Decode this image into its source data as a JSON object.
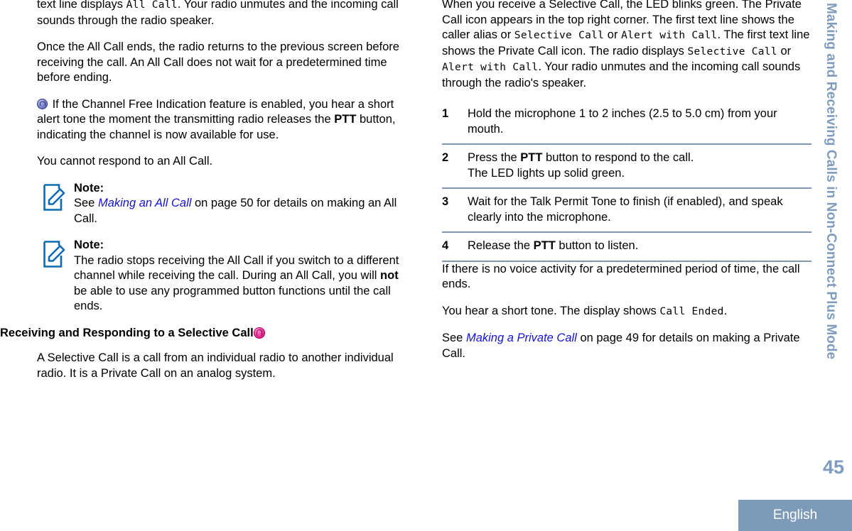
{
  "document": {
    "rail_title": "Making and Receiving Calls in Non-Connect Plus Mode",
    "page_number": "45",
    "language_badge": "English"
  },
  "left_column": {
    "paragraphs": [
      {
        "id": "p1",
        "segments": [
          {
            "type": "text",
            "text": "text line displays "
          },
          {
            "type": "mono",
            "text": "All Call"
          },
          {
            "type": "text",
            "text": ". Your radio unmutes and the incoming call sounds through the radio speaker."
          }
        ]
      },
      {
        "id": "p2",
        "segments": [
          {
            "type": "text",
            "text": "Once the All Call ends, the radio returns to the previous screen before receiving the call. An All Call does not wait for a predetermined time before ending."
          }
        ]
      },
      {
        "id": "p3",
        "icon": "channel-free-indication-icon",
        "segments": [
          {
            "type": "text",
            "text": " If the Channel Free Indication feature is enabled, you hear a short alert tone the moment the transmitting radio releases the "
          },
          {
            "type": "bold",
            "text": "PTT"
          },
          {
            "type": "text",
            "text": " button, indicating the channel is now available for use."
          }
        ]
      },
      {
        "id": "p4",
        "segments": [
          {
            "type": "text",
            "text": "You cannot respond to an All Call."
          }
        ]
      }
    ],
    "notes": [
      {
        "id": "note1",
        "title": "Note:",
        "segments": [
          {
            "type": "text",
            "text": "See "
          },
          {
            "type": "xref",
            "text": "Making an All Call"
          },
          {
            "type": "text",
            "text": " on page 50 for details on making an All Call."
          }
        ]
      },
      {
        "id": "note2",
        "title": "Note:",
        "segments": [
          {
            "type": "text",
            "text": "The radio stops receiving the All Call if you switch to a different channel while receiving the call. During an All Call, you will "
          },
          {
            "type": "bold",
            "text": "not"
          },
          {
            "type": "text",
            "text": " be able to use any programmed button functions until the call ends."
          }
        ]
      }
    ],
    "section_heading": {
      "text": "Receiving and Responding to a Selective Call",
      "icon": "private-call-icon"
    },
    "section_paragraphs": [
      {
        "id": "sp1",
        "segments": [
          {
            "type": "text",
            "text": "A Selective Call is a call from an individual radio to another individual radio. It is a Private Call on an analog system."
          }
        ]
      }
    ]
  },
  "right_column": {
    "intro": {
      "id": "rp1",
      "segments": [
        {
          "type": "text",
          "text": "When you receive a Selective Call, the LED blinks green. The Private Call icon appears in the top right corner. The first text line shows the caller alias or "
        },
        {
          "type": "mono",
          "text": "Selective Call"
        },
        {
          "type": "text",
          "text": " or "
        },
        {
          "type": "mono",
          "text": "Alert with Call"
        },
        {
          "type": "text",
          "text": ". The first text line shows the Private Call icon. The radio displays "
        },
        {
          "type": "mono",
          "text": "Selective Call"
        },
        {
          "type": "text",
          "text": " or "
        },
        {
          "type": "mono",
          "text": "Alert with Call"
        },
        {
          "type": "text",
          "text": ". Your radio unmutes and the incoming call sounds through the radio's speaker."
        }
      ]
    },
    "steps": [
      {
        "number": "1",
        "segments": [
          {
            "type": "text",
            "text": "Hold the microphone 1 to 2 inches (2.5 to 5.0 cm) from your mouth."
          }
        ]
      },
      {
        "number": "2",
        "segments": [
          {
            "type": "text",
            "text": "Press the "
          },
          {
            "type": "bold",
            "text": "PTT"
          },
          {
            "type": "text",
            "text": " button to respond to the call."
          },
          {
            "type": "break"
          },
          {
            "type": "text",
            "text": "The LED lights up solid green."
          }
        ]
      },
      {
        "number": "3",
        "segments": [
          {
            "type": "text",
            "text": "Wait for the Talk Permit Tone to finish (if enabled), and speak clearly into the microphone."
          }
        ]
      },
      {
        "number": "4",
        "segments": [
          {
            "type": "text",
            "text": "Release the "
          },
          {
            "type": "bold",
            "text": "PTT"
          },
          {
            "type": "text",
            "text": " button to listen."
          }
        ]
      }
    ],
    "closing_paragraphs": [
      {
        "id": "rc1",
        "segments": [
          {
            "type": "text",
            "text": "If there is no voice activity for a predetermined period of time, the call ends."
          }
        ]
      },
      {
        "id": "rc2",
        "segments": [
          {
            "type": "text",
            "text": "You hear a short tone. The display shows "
          },
          {
            "type": "mono",
            "text": "Call Ended"
          },
          {
            "type": "text",
            "text": "."
          }
        ]
      },
      {
        "id": "rc3",
        "segments": [
          {
            "type": "text",
            "text": "See "
          },
          {
            "type": "xref",
            "text": "Making a Private Call"
          },
          {
            "type": "text",
            "text": " on page 49 for details on making a Private Call."
          }
        ]
      }
    ]
  },
  "colors": {
    "accent_blue_gray": "#7d9bb8",
    "rule_blue_gray": "#8196b0",
    "link_blue": "#1414d2",
    "private_call_pink": "#f03fa0",
    "channel_free_blue": "#8189cf"
  }
}
